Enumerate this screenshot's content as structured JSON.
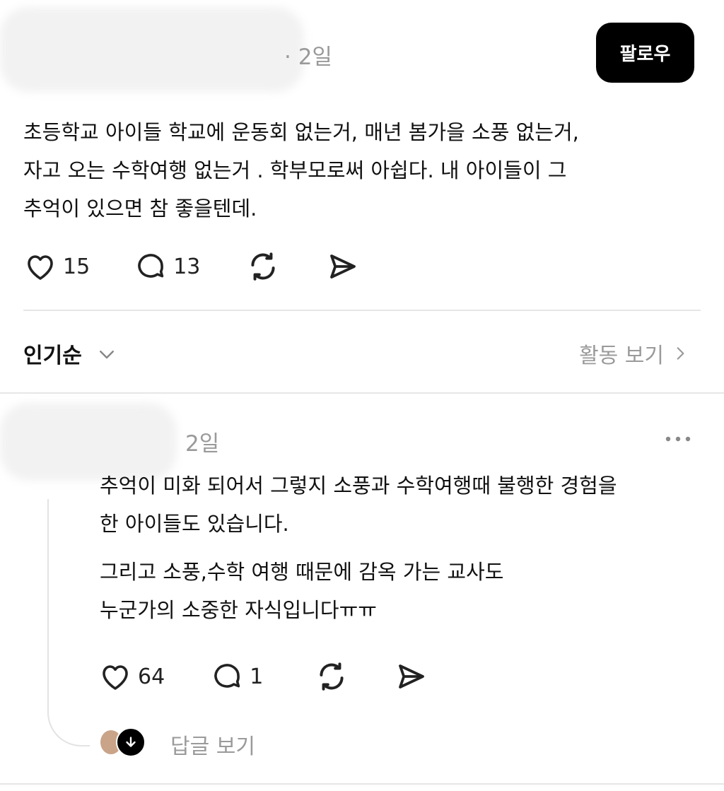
{
  "post": {
    "timestamp": "· 2일",
    "follow_label": "팔로우",
    "body": [
      "초등학교 아이들 학교에 운동회 없는거, 매년 봄가을 소풍 없는거,",
      "자고 오는 수학여행 없는거 . 학부모로써 아쉽다. 내 아이들이 그",
      "추억이 있으면 참 좋을텐데."
    ],
    "likes": "15",
    "comments": "13"
  },
  "sort": {
    "label": "인기순",
    "activity_label": "활동 보기"
  },
  "comment": {
    "timestamp": "2일",
    "paragraph1": [
      "추억이 미화 되어서 그렇지 소풍과 수학여행때 불행한 경험을",
      "한 아이들도 있습니다."
    ],
    "paragraph2": [
      "그리고 소풍,수학 여행 때문에 감옥 가는 교사도",
      "누군가의 소중한 자식입니다ㅠㅠ"
    ],
    "likes": "64",
    "comments": "1",
    "reply_label": "답글 보기"
  },
  "icons": [
    "heart-icon",
    "comment-icon",
    "repost-icon",
    "share-icon",
    "chevron-down-icon",
    "chevron-right-icon",
    "more-icon",
    "arrow-down-icon"
  ]
}
